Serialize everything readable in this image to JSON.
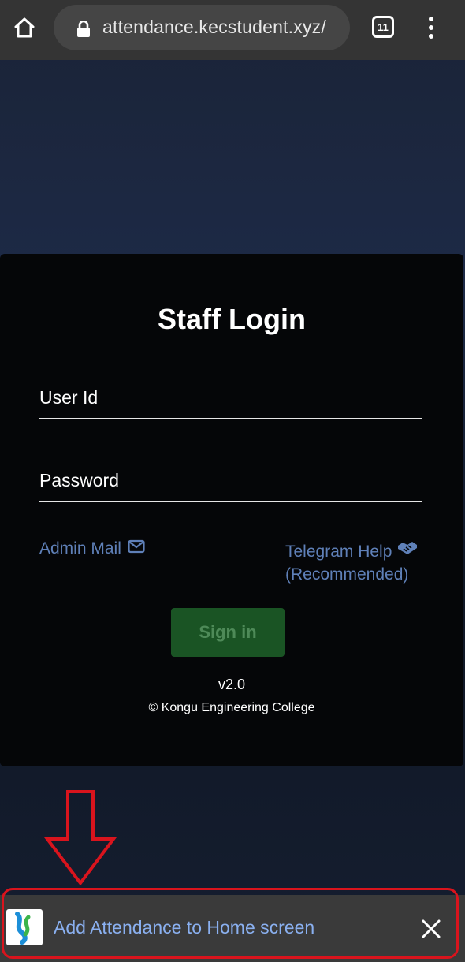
{
  "browser": {
    "url": "attendance.kecstudent.xyz/",
    "tab_count": "11",
    "icons": {
      "home": "home-icon",
      "lock": "lock-icon",
      "tabs": "tab-switcher-icon",
      "menu": "more-vert-icon"
    }
  },
  "login": {
    "title": "Staff Login",
    "user_id_placeholder": "User Id",
    "password_placeholder": "Password",
    "admin_mail_label": "Admin Mail",
    "telegram_help_label": "Telegram Help",
    "telegram_help_note": "(Recommended)",
    "sign_in_label": "Sign in",
    "version": "v2.0",
    "copyright": "© Kongu Engineering College"
  },
  "a2hs_banner": {
    "label": "Add Attendance to Home screen",
    "icons": {
      "app": "app-logo-icon",
      "close": "close-icon"
    }
  },
  "colors": {
    "browser_bar": "#343434",
    "card_bg": "#050608",
    "link": "#5f80b8",
    "signin_bg": "#1a5424",
    "signin_text": "#4e8a58",
    "banner_text": "#8ab0f0",
    "highlight": "#d9141d"
  }
}
